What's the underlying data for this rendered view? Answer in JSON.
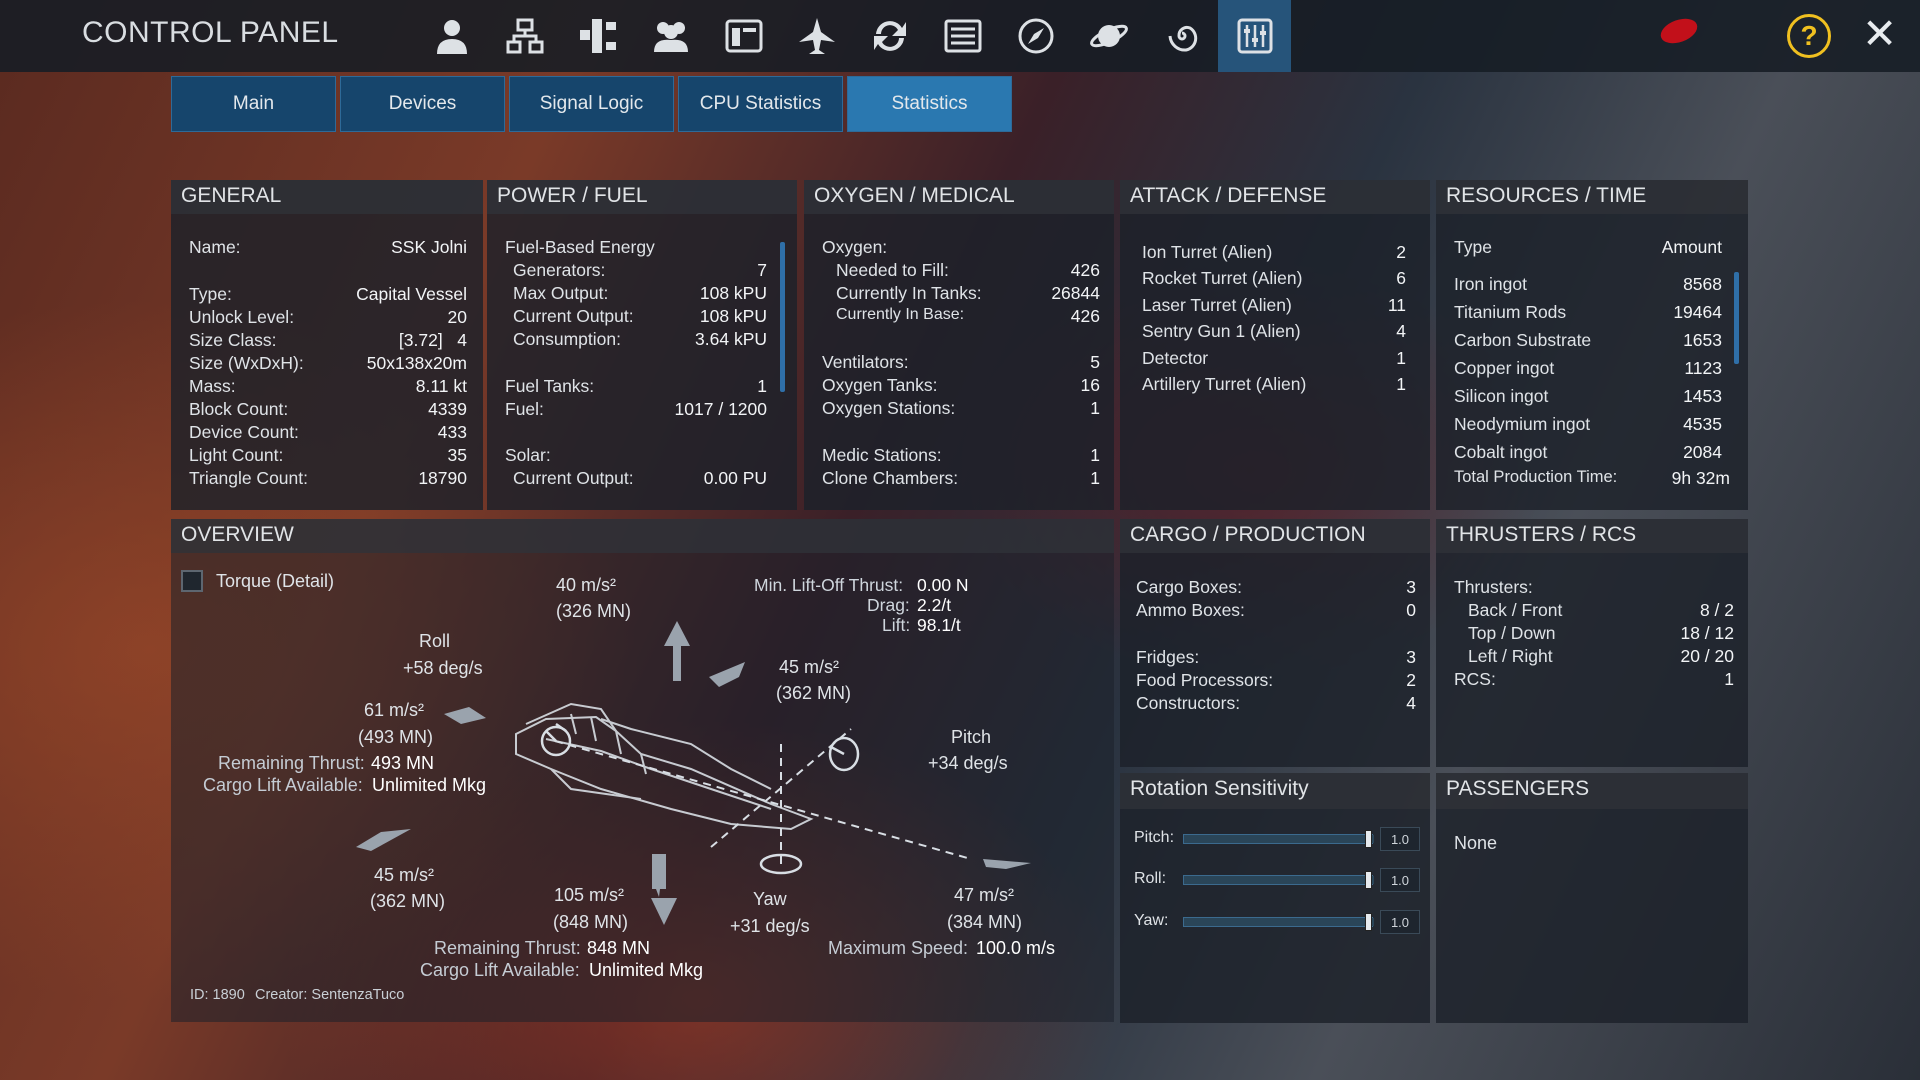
{
  "header": {
    "title": "CONTROL PANEL",
    "icons": [
      "person-icon",
      "network-icon",
      "structure-icon",
      "group-icon",
      "window-icon",
      "ship-icon",
      "sync-icon",
      "list-icon",
      "compass-icon",
      "planet-icon",
      "galaxy-icon",
      "sliders-icon"
    ],
    "help": "?",
    "close": "✕"
  },
  "tabs": [
    "Main",
    "Devices",
    "Signal Logic",
    "CPU Statistics",
    "Statistics"
  ],
  "general": {
    "title": "GENERAL",
    "name_label": "Name:",
    "name": "SSK Jolni",
    "rows": [
      [
        "Type:",
        "Capital Vessel"
      ],
      [
        "Unlock Level:",
        "20"
      ],
      [
        "Size Class:",
        "[3.72]   4"
      ],
      [
        "Size (WxDxH):",
        "50x138x20m"
      ],
      [
        "Mass:",
        "8.11 kt"
      ],
      [
        "Block Count:",
        "4339"
      ],
      [
        "Device Count:",
        "433"
      ],
      [
        "Light Count:",
        "35"
      ],
      [
        "Triangle Count:",
        "18790"
      ]
    ]
  },
  "power": {
    "title": "POWER / FUEL",
    "fuel_energy": "Fuel-Based Energy",
    "rows": [
      [
        "Generators:",
        "7"
      ],
      [
        "Max Output:",
        "108 kPU"
      ],
      [
        "Current Output:",
        "108 kPU"
      ],
      [
        "Consumption:",
        "3.64 kPU"
      ]
    ],
    "tanks": [
      [
        "Fuel Tanks:",
        "1"
      ],
      [
        "Fuel:",
        "1017 / 1200"
      ]
    ],
    "solar": "Solar:",
    "solar_rows": [
      [
        "Current Output:",
        "0.00 PU"
      ]
    ]
  },
  "oxygen": {
    "title": "OXYGEN / MEDICAL",
    "oxygen": "Oxygen:",
    "rows": [
      [
        "Needed to Fill:",
        "426"
      ],
      [
        "Currently In Tanks:",
        "26844"
      ],
      [
        "Currently In Base:",
        "426"
      ]
    ],
    "rows2": [
      [
        "Ventilators:",
        "5"
      ],
      [
        "Oxygen Tanks:",
        "16"
      ],
      [
        "Oxygen Stations:",
        "1"
      ]
    ],
    "rows3": [
      [
        "Medic Stations:",
        "1"
      ],
      [
        "Clone Chambers:",
        "1"
      ]
    ]
  },
  "attack": {
    "title": "ATTACK / DEFENSE",
    "rows": [
      [
        "Ion Turret (Alien)",
        "2"
      ],
      [
        "Rocket Turret (Alien)",
        "6"
      ],
      [
        "Laser Turret (Alien)",
        "11"
      ],
      [
        "Sentry Gun 1 (Alien)",
        "4"
      ],
      [
        "Detector",
        "1"
      ],
      [
        "Artillery Turret (Alien)",
        "1"
      ]
    ]
  },
  "resources": {
    "title": "RESOURCES / TIME",
    "col_type": "Type",
    "col_amount": "Amount",
    "rows": [
      [
        "Iron ingot",
        "8568"
      ],
      [
        "Titanium Rods",
        "19464"
      ],
      [
        "Carbon Substrate",
        "1653"
      ],
      [
        "Copper ingot",
        "1123"
      ],
      [
        "Silicon ingot",
        "1453"
      ],
      [
        "Neodymium ingot",
        "4535"
      ],
      [
        "Cobalt ingot",
        "2084"
      ]
    ],
    "total_label": "Total Production Time:",
    "total": "9h 32m"
  },
  "overview": {
    "title": "OVERVIEW",
    "torque": "Torque (Detail)",
    "up_acc": "40 m/s²",
    "up_thrust": "(326 MN)",
    "min_lift": "Min. Lift-Off Thrust:",
    "min_lift_val": "0.00 N",
    "drag": "Drag:",
    "drag_val": "2.2/t",
    "lift": "Lift:",
    "lift_val": "98.1/t",
    "roll": "Roll",
    "roll_val": "+58 deg/s",
    "fwd_acc": "45 m/s²",
    "fwd_thrust": "(362 MN)",
    "back_acc": "61 m/s²",
    "back_thrust": "(493 MN)",
    "rem_thrust": "Remaining Thrust:",
    "rem_thrust_val": "493 MN",
    "cargo_lift": "Cargo Lift Available:",
    "cargo_lift_val": "Unlimited Mkg",
    "pitch": "Pitch",
    "pitch_val": "+34 deg/s",
    "left_acc": "45 m/s²",
    "left_thrust": "(362 MN)",
    "down_acc": "105 m/s²",
    "down_thrust": "(848 MN)",
    "yaw": "Yaw",
    "yaw_val": "+31 deg/s",
    "right_acc": "47 m/s²",
    "right_thrust": "(384 MN)",
    "rem_thrust2_val": "848 MN",
    "cargo_lift2_val": "Unlimited Mkg",
    "max_speed": "Maximum Speed:",
    "max_speed_val": "100.0 m/s",
    "id": "ID: 1890",
    "creator": "Creator: SentenzaTuco"
  },
  "cargo": {
    "title": "CARGO / PRODUCTION",
    "rows": [
      [
        "Cargo Boxes:",
        "3"
      ],
      [
        "Ammo Boxes:",
        "0"
      ]
    ],
    "rows2": [
      [
        "Fridges:",
        "3"
      ],
      [
        "Food Processors:",
        "2"
      ],
      [
        "Constructors:",
        "4"
      ]
    ]
  },
  "thrusters": {
    "title": "THRUSTERS / RCS",
    "label": "Thrusters:",
    "rows": [
      [
        "Back / Front",
        "8 / 2"
      ],
      [
        "Top / Down",
        "18 / 12"
      ],
      [
        "Left / Right",
        "20 / 20"
      ]
    ],
    "rcs": "RCS:",
    "rcs_val": "1"
  },
  "rotation": {
    "title": "Rotation Sensitivity",
    "sliders": [
      {
        "label": "Pitch:",
        "value": "1.0",
        "level": 1.0
      },
      {
        "label": "Roll:",
        "value": "1.0",
        "level": 1.0
      },
      {
        "label": "Yaw:",
        "value": "1.0",
        "level": 1.0
      }
    ]
  },
  "passengers": {
    "title": "PASSENGERS",
    "value": "None"
  }
}
